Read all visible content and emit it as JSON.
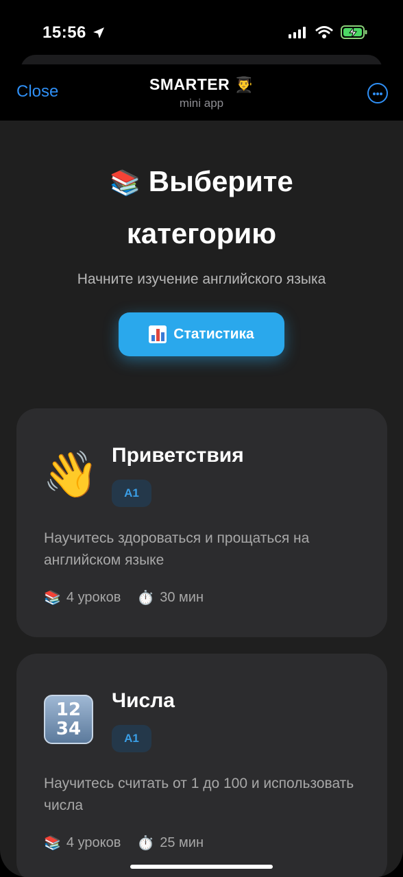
{
  "status": {
    "time": "15:56"
  },
  "header": {
    "close_label": "Close",
    "title": "SMARTER",
    "title_emoji": "👨‍🎓",
    "subtitle": "mini app"
  },
  "main": {
    "heading_emoji": "📚",
    "heading": "Выберите категорию",
    "subtitle": "Начните изучение английского языка",
    "stats_button": "Статистика"
  },
  "categories": [
    {
      "icon": "👋",
      "title": "Приветствия",
      "level": "A1",
      "description": "Научитесь здороваться и прощаться на английском языке",
      "lessons_icon": "📚",
      "lessons": "4 уроков",
      "time_icon": "⏱️",
      "duration": "30 мин"
    },
    {
      "icon_text": "1 2 3 4",
      "title": "Числа",
      "level": "A1",
      "description": "Научитесь считать от 1 до 100 и использовать числа",
      "lessons_icon": "📚",
      "lessons": "4 уроков",
      "time_icon": "⏱️",
      "duration": "25 мин"
    }
  ],
  "colors": {
    "accent": "#2aa8ec",
    "link": "#2f8ff5",
    "card_bg": "#2c2c2e",
    "page_bg": "#1f1f1f",
    "badge_text": "#3a9ee6"
  }
}
